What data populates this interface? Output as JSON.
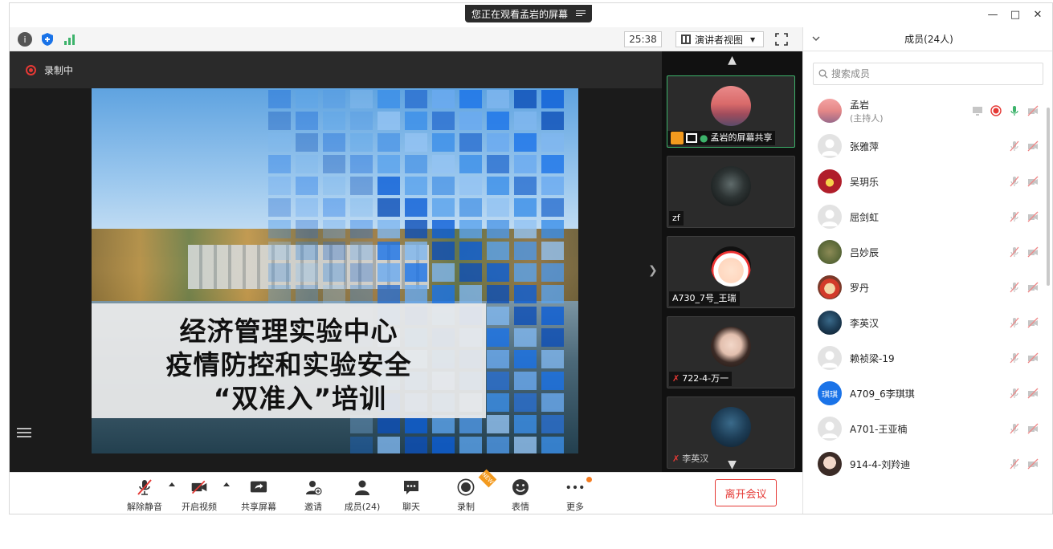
{
  "titlebar": {
    "sharing_text": "您正在观看孟岩的屏幕"
  },
  "topbar": {
    "timer": "25:38",
    "view_mode": "演讲者视图"
  },
  "stage": {
    "recording_label": "录制中",
    "slide_lines": [
      "经济管理实验中心",
      "疫情防控和实验安全",
      "“双准入”培训"
    ]
  },
  "video_strip": [
    {
      "label": "孟岩的屏幕共享"
    },
    {
      "label": "zf"
    },
    {
      "label": "A730_7号_王瑞"
    },
    {
      "label": "722-4-万一"
    },
    {
      "label": "李英汉"
    }
  ],
  "controls": {
    "mute": "解除静音",
    "video": "开启视频",
    "share": "共享屏幕",
    "invite": "邀请",
    "members": "成员(24)",
    "chat": "聊天",
    "record": "录制",
    "record_badge": "NEW",
    "emoji": "表情",
    "more": "更多",
    "leave": "离开会议"
  },
  "panel": {
    "title": "成员(24人)",
    "search_placeholder": "搜索成员",
    "members": [
      {
        "name": "孟岩",
        "role": "(主持人)"
      },
      {
        "name": "张雅萍"
      },
      {
        "name": "吴玥乐"
      },
      {
        "name": "屈剑虹"
      },
      {
        "name": "吕妙辰"
      },
      {
        "name": "罗丹"
      },
      {
        "name": "李英汉"
      },
      {
        "name": "赖祯梁-19"
      },
      {
        "name": "A709_6李琪琪",
        "avatar_text": "琪琪"
      },
      {
        "name": "A701-王亚楠"
      },
      {
        "name": "914-4-刘羚迪"
      }
    ]
  },
  "colors": {
    "record_red": "#e53935",
    "accent_blue": "#1a73e8",
    "mic_green": "#3db36b"
  }
}
